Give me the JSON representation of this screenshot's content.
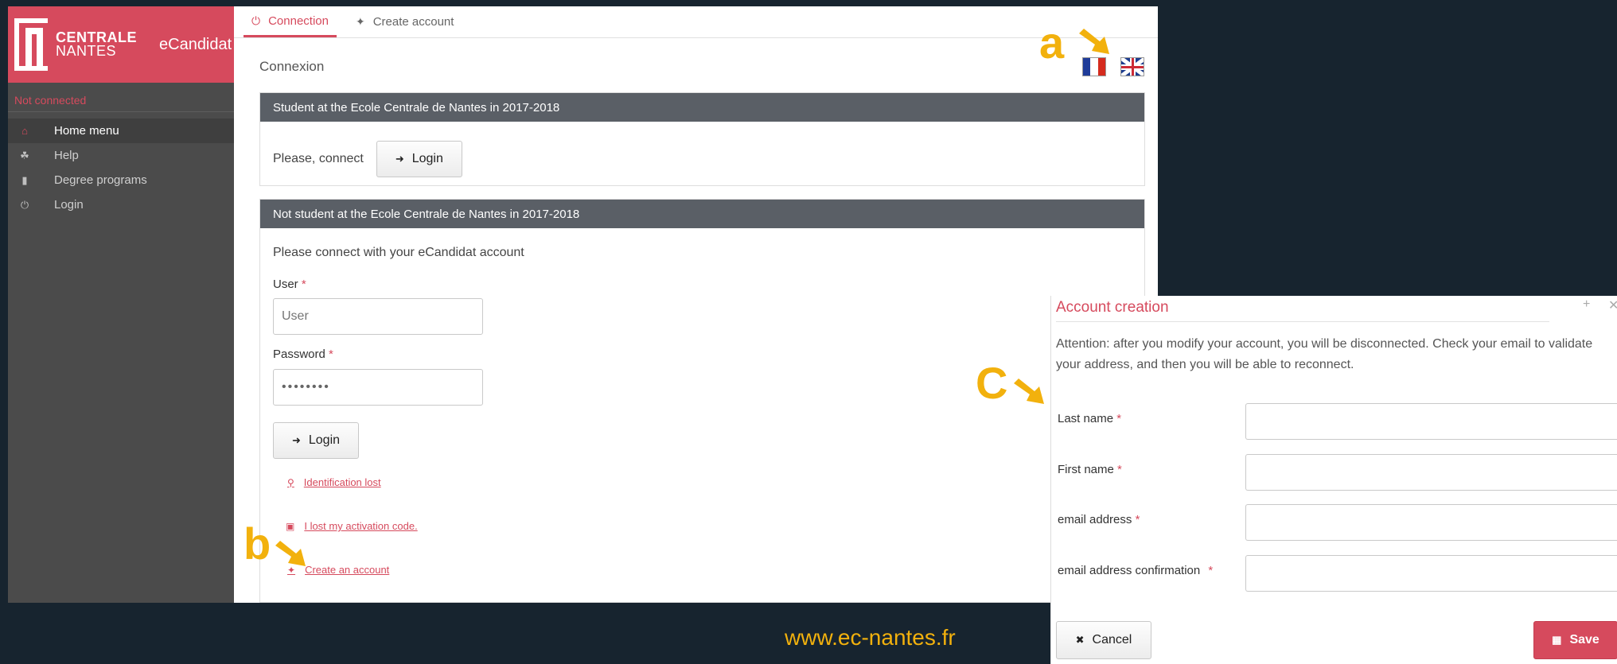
{
  "sidebar": {
    "logo_line1": "CENTRALE",
    "logo_line2": "NANTES",
    "app_name": "eCandidat",
    "status": "Not connected",
    "items": [
      {
        "label": "Home menu",
        "icon": "home-icon",
        "active": true
      },
      {
        "label": "Help",
        "icon": "help-icon",
        "active": false
      },
      {
        "label": "Degree programs",
        "icon": "bookmark-icon",
        "active": false
      },
      {
        "label": "Login",
        "icon": "power-icon",
        "active": false
      }
    ]
  },
  "tabs": [
    {
      "label": "Connection",
      "icon": "power-icon",
      "active": true
    },
    {
      "label": "Create account",
      "icon": "wand-icon",
      "active": false
    }
  ],
  "page_title": "Connexion",
  "panel_student": {
    "header": "Student at the Ecole Centrale de Nantes in 2017-2018",
    "prompt": "Please, connect",
    "login_label": "Login"
  },
  "panel_nonstudent": {
    "header": "Not student at the Ecole Centrale de Nantes in 2017-2018",
    "intro": "Please connect with your eCandidat account",
    "user_label": "User",
    "user_placeholder": "User",
    "password_label": "Password",
    "password_value": "••••••••",
    "login_label": "Login",
    "links": {
      "identification_lost": "Identification lost",
      "lost_activation": "I lost my activation code.",
      "create_account": "Create an account"
    }
  },
  "required_mark": "*",
  "dialog": {
    "title": "Account creation",
    "message": "Attention: after you modify your account, you will be disconnected. Check your email to validate your address, and then you will be able to reconnect.",
    "fields": {
      "last_name": "Last name",
      "first_name": "First name",
      "email": "email address",
      "email_confirm": "email address confirmation"
    },
    "cancel_label": "Cancel",
    "save_label": "Save"
  },
  "annotations": {
    "a": "a",
    "b": "b",
    "c": "C"
  },
  "footer_url": "www.ec-nantes.fr",
  "colors": {
    "accent": "#d64a5d",
    "annotation": "#f2b10d",
    "background": "#17242f",
    "sidebar": "#4b4b4b",
    "panel_header": "#5a5f66"
  }
}
